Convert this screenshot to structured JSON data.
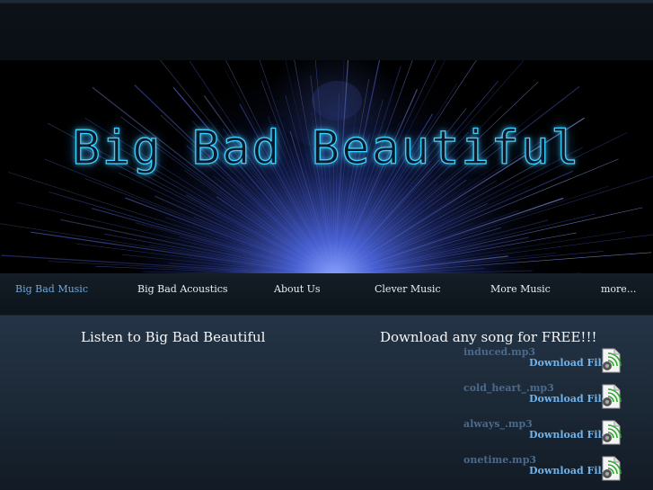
{
  "banner": {
    "title": "Big Bad Beautiful"
  },
  "nav": {
    "items": [
      {
        "label": "Big Bad Music",
        "active": true
      },
      {
        "label": "Big Bad Acoustics"
      },
      {
        "label": "About Us"
      },
      {
        "label": "Clever Music"
      },
      {
        "label": "More Music"
      },
      {
        "label": "more..."
      }
    ]
  },
  "main": {
    "listen_heading": "Listen to Big Bad Beautiful",
    "download_heading": "Download any song for FREE!!!",
    "downloads": [
      {
        "file": "induced.mp3",
        "link": "Download File"
      },
      {
        "file": "cold_heart_.mp3",
        "link": "Download File"
      },
      {
        "file": "always_.mp3",
        "link": "Download File"
      },
      {
        "file": "onetime.mp3",
        "link": "Download File"
      }
    ]
  },
  "icons": {
    "download": "audio-file-icon"
  },
  "colors": {
    "accent": "#6fb3ec",
    "active_nav": "#6ea8e0",
    "title_glow": "#3ad2ff"
  }
}
